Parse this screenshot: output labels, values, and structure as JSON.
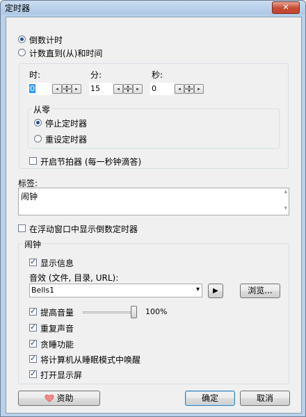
{
  "window": {
    "title": "定时器",
    "close_glyph": "✕"
  },
  "mode": {
    "countdown_label": "倒数计时",
    "countup_label": "计数直到(从)和时间",
    "selected": "countdown"
  },
  "time": {
    "hour_label": "时:",
    "hour_value": "0",
    "minute_label": "分:",
    "minute_value": "15",
    "second_label": "秒:",
    "second_value": "0"
  },
  "from_zero": {
    "title": "从零",
    "stop_label": "停止定时器",
    "reset_label": "重设定时器",
    "selected": "stop"
  },
  "metronome": {
    "label": "开启节拍器 (每一秒钟滴答)",
    "checked": false
  },
  "tag": {
    "label": "标签:",
    "value": "闹钟"
  },
  "floating": {
    "label": "在浮动窗口中显示倒数定时器",
    "checked": false
  },
  "alarm": {
    "title": "闹钟",
    "show_info": {
      "label": "显示信息",
      "checked": true
    },
    "sound_label": "音效 (文件, 目录, URL):",
    "sound_value": "Bells1",
    "play_glyph": "▶",
    "browse_label": "浏览...",
    "raise_volume": {
      "label": "提高音量",
      "checked": true,
      "volume_value": "100%",
      "level": 1.0
    },
    "repeat": {
      "label": "重复声音",
      "checked": true
    },
    "snooze": {
      "label": "贪睡功能",
      "checked": true
    },
    "wake": {
      "label": "将计算机从睡眠模式中唤醒",
      "checked": true
    },
    "display": {
      "label": "打开显示屏",
      "checked": true
    }
  },
  "buttons": {
    "donate": "资助",
    "ok": "确定",
    "cancel": "取消"
  },
  "icons": {
    "heart": "heart-icon",
    "spin_left": "◂",
    "spin_up": "▴",
    "spin_down": "▾",
    "spin_right": "▸",
    "dropdown": "▾",
    "scroll_up": "▴",
    "scroll_down": "▾"
  }
}
